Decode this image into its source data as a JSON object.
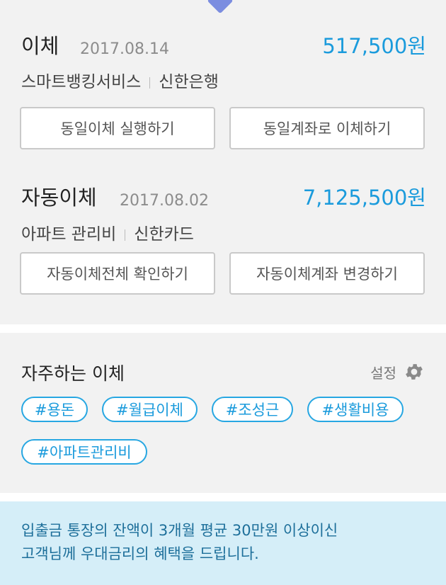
{
  "transfers": [
    {
      "title": "이체",
      "date": "2017.08.14",
      "amount": "517,500원",
      "service": "스마트뱅킹서비스",
      "institution": "신한은행",
      "buttons": [
        "동일이체 실행하기",
        "동일계좌로 이체하기"
      ]
    },
    {
      "title": "자동이체",
      "date": "2017.08.02",
      "amount": "7,125,500원",
      "service": "아파트 관리비",
      "institution": "신한카드",
      "buttons": [
        "자동이체전체 확인하기",
        "자동이체계좌 변경하기"
      ]
    }
  ],
  "favorites": {
    "title": "자주하는 이체",
    "settings_label": "설정",
    "settings_icon": "gear-icon",
    "tags": [
      "#용돈",
      "#월급이체",
      "#조성근",
      "#생활비용",
      "#아파트관리비"
    ]
  },
  "notice": {
    "lines": [
      "입출금 통장의 잔액이 3개월 평균 30만원 이상이신",
      "고객님께 우대금리의 혜택을 드립니다."
    ]
  },
  "colors": {
    "accent": "#1b9bdc",
    "panel_bg": "#f2f2f2",
    "notice_bg": "#d5eef8",
    "pointer": "#7b8de0"
  }
}
